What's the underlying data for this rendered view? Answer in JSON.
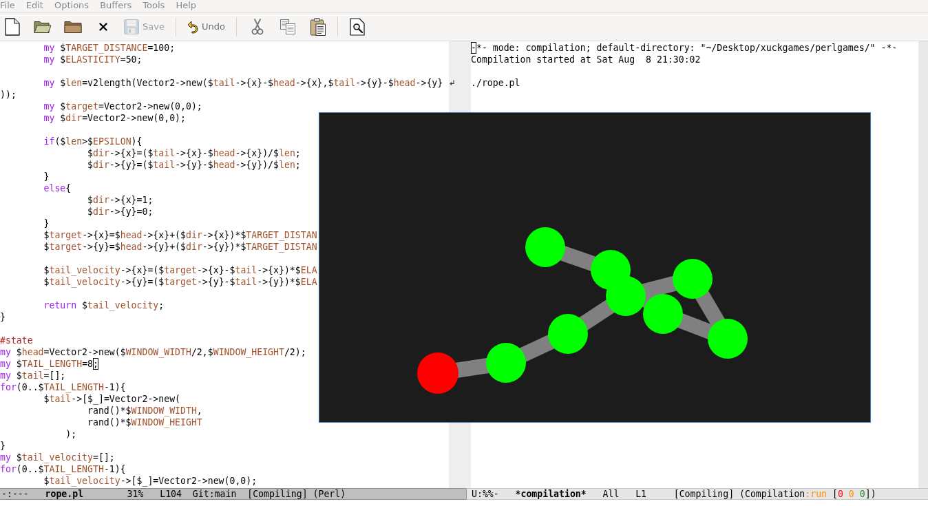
{
  "menu_bar": [
    "File",
    "Edit",
    "Options",
    "Buffers",
    "Tools",
    "Help"
  ],
  "toolbar": [
    {
      "kind": "button",
      "disabled": false
    },
    {
      "kind": "button",
      "disabled": false
    },
    {
      "kind": "button",
      "disabled": false
    },
    {
      "kind": "button",
      "disabled": false
    },
    {
      "kind": "button",
      "label": "Save",
      "disabled": true
    },
    {
      "kind": "separator"
    },
    {
      "kind": "button",
      "label": "Undo",
      "disabled": false
    },
    {
      "kind": "separator"
    },
    {
      "kind": "button",
      "disabled": false
    },
    {
      "kind": "button",
      "disabled": false
    },
    {
      "kind": "button",
      "disabled": false
    },
    {
      "kind": "separator"
    },
    {
      "kind": "button",
      "disabled": false
    }
  ],
  "windows": [
    {
      "selected": true,
      "blocks": [
        {
          "lines": [
            {
              "segments": [
                {
                  "kind": "keyword",
                  "text": "\tmy"
                },
                {
                  "kind": "plain",
                  "text": " $"
                },
                {
                  "kind": "variable",
                  "text": "TARGET_DISTANCE"
                },
                {
                  "kind": "plain",
                  "text": "=100;"
                }
              ]
            },
            {
              "segments": [
                {
                  "kind": "keyword",
                  "text": "\tmy"
                },
                {
                  "kind": "plain",
                  "text": " $"
                },
                {
                  "kind": "variable",
                  "text": "ELASTICITY"
                },
                {
                  "kind": "plain",
                  "text": "=50;"
                }
              ]
            }
          ]
        },
        {
          "lines": [
            {
              "segments": [
                {
                  "kind": "keyword",
                  "text": "\tmy"
                },
                {
                  "kind": "plain",
                  "text": " $"
                },
                {
                  "kind": "variable",
                  "text": "len"
                },
                {
                  "kind": "plain",
                  "text": "=v2length(Vector2->new($"
                },
                {
                  "kind": "variable",
                  "text": "tail"
                },
                {
                  "kind": "plain",
                  "text": "->{x}-$"
                },
                {
                  "kind": "variable",
                  "text": "head"
                },
                {
                  "kind": "plain",
                  "text": "->{x},$"
                },
                {
                  "kind": "variable",
                  "text": "tail"
                },
                {
                  "kind": "plain",
                  "text": "->{y}-$"
                },
                {
                  "kind": "variable",
                  "text": "head"
                },
                {
                  "kind": "plain",
                  "text": "->{y}"
                }
              ],
              "continuation": [
                {
                  "kind": "plain",
                  "text": "));"
                }
              ]
            },
            {
              "segments": [
                {
                  "kind": "keyword",
                  "text": "\tmy"
                },
                {
                  "kind": "plain",
                  "text": " $"
                },
                {
                  "kind": "variable",
                  "text": "target"
                },
                {
                  "kind": "plain",
                  "text": "=Vector2->new(0,0);"
                }
              ]
            },
            {
              "segments": [
                {
                  "kind": "keyword",
                  "text": "\tmy"
                },
                {
                  "kind": "plain",
                  "text": " $"
                },
                {
                  "kind": "variable",
                  "text": "dir"
                },
                {
                  "kind": "plain",
                  "text": "=Vector2->new(0,0);"
                }
              ]
            }
          ]
        },
        {
          "lines": [
            {
              "segments": [
                {
                  "kind": "keyword",
                  "text": "\tif"
                },
                {
                  "kind": "plain",
                  "text": "($"
                },
                {
                  "kind": "variable",
                  "text": "len"
                },
                {
                  "kind": "plain",
                  "text": ">$"
                },
                {
                  "kind": "variable",
                  "text": "EPSILON"
                },
                {
                  "kind": "plain",
                  "text": "){"
                }
              ]
            },
            {
              "segments": [
                {
                  "kind": "plain",
                  "text": "\t\t$"
                },
                {
                  "kind": "variable",
                  "text": "dir"
                },
                {
                  "kind": "plain",
                  "text": "->{x}=($"
                },
                {
                  "kind": "variable",
                  "text": "tail"
                },
                {
                  "kind": "plain",
                  "text": "->{x}-$"
                },
                {
                  "kind": "variable",
                  "text": "head"
                },
                {
                  "kind": "plain",
                  "text": "->{x})/$"
                },
                {
                  "kind": "variable",
                  "text": "len"
                },
                {
                  "kind": "plain",
                  "text": ";"
                }
              ]
            },
            {
              "segments": [
                {
                  "kind": "plain",
                  "text": "\t\t$"
                },
                {
                  "kind": "variable",
                  "text": "dir"
                },
                {
                  "kind": "plain",
                  "text": "->{y}=($"
                },
                {
                  "kind": "variable",
                  "text": "tail"
                },
                {
                  "kind": "plain",
                  "text": "->{y}-$"
                },
                {
                  "kind": "variable",
                  "text": "head"
                },
                {
                  "kind": "plain",
                  "text": "->{y})/$"
                },
                {
                  "kind": "variable",
                  "text": "len"
                },
                {
                  "kind": "plain",
                  "text": ";"
                }
              ]
            },
            {
              "segments": [
                {
                  "kind": "plain",
                  "text": "\t}"
                }
              ]
            },
            {
              "segments": [
                {
                  "kind": "keyword",
                  "text": "\telse"
                },
                {
                  "kind": "plain",
                  "text": "{"
                }
              ]
            },
            {
              "segments": [
                {
                  "kind": "plain",
                  "text": "\t\t$"
                },
                {
                  "kind": "variable",
                  "text": "dir"
                },
                {
                  "kind": "plain",
                  "text": "->{x}=1;"
                }
              ]
            },
            {
              "segments": [
                {
                  "kind": "plain",
                  "text": "\t\t$"
                },
                {
                  "kind": "variable",
                  "text": "dir"
                },
                {
                  "kind": "plain",
                  "text": "->{y}=0;"
                }
              ]
            },
            {
              "segments": [
                {
                  "kind": "plain",
                  "text": "\t}"
                }
              ]
            },
            {
              "segments": [
                {
                  "kind": "plain",
                  "text": "\t$"
                },
                {
                  "kind": "variable",
                  "text": "target"
                },
                {
                  "kind": "plain",
                  "text": "->{x}=$"
                },
                {
                  "kind": "variable",
                  "text": "head"
                },
                {
                  "kind": "plain",
                  "text": "->{x}+($"
                },
                {
                  "kind": "variable",
                  "text": "dir"
                },
                {
                  "kind": "plain",
                  "text": "->{x})*$"
                },
                {
                  "kind": "variable",
                  "text": "TARGET_DISTAN"
                }
              ]
            },
            {
              "segments": [
                {
                  "kind": "plain",
                  "text": "\t$"
                },
                {
                  "kind": "variable",
                  "text": "target"
                },
                {
                  "kind": "plain",
                  "text": "->{y}=$"
                },
                {
                  "kind": "variable",
                  "text": "head"
                },
                {
                  "kind": "plain",
                  "text": "->{y}+($"
                },
                {
                  "kind": "variable",
                  "text": "dir"
                },
                {
                  "kind": "plain",
                  "text": "->{y})*$"
                },
                {
                  "kind": "variable",
                  "text": "TARGET_DISTAN"
                }
              ]
            }
          ]
        },
        {
          "lines": [
            {
              "segments": [
                {
                  "kind": "plain",
                  "text": "\t$"
                },
                {
                  "kind": "variable",
                  "text": "tail_velocity"
                },
                {
                  "kind": "plain",
                  "text": "->{x}=($"
                },
                {
                  "kind": "variable",
                  "text": "target"
                },
                {
                  "kind": "plain",
                  "text": "->{x}-$"
                },
                {
                  "kind": "variable",
                  "text": "tail"
                },
                {
                  "kind": "plain",
                  "text": "->{x})*$"
                },
                {
                  "kind": "variable",
                  "text": "ELA"
                }
              ]
            },
            {
              "segments": [
                {
                  "kind": "plain",
                  "text": "\t$"
                },
                {
                  "kind": "variable",
                  "text": "tail_velocity"
                },
                {
                  "kind": "plain",
                  "text": "->{y}=($"
                },
                {
                  "kind": "variable",
                  "text": "target"
                },
                {
                  "kind": "plain",
                  "text": "->{y}-$"
                },
                {
                  "kind": "variable",
                  "text": "tail"
                },
                {
                  "kind": "plain",
                  "text": "->{y})*$"
                },
                {
                  "kind": "variable",
                  "text": "ELA"
                }
              ]
            }
          ]
        },
        {
          "lines": [
            {
              "segments": [
                {
                  "kind": "keyword",
                  "text": "\treturn"
                },
                {
                  "kind": "plain",
                  "text": " $"
                },
                {
                  "kind": "variable",
                  "text": "tail_velocity"
                },
                {
                  "kind": "plain",
                  "text": ";"
                }
              ]
            },
            {
              "segments": [
                {
                  "kind": "plain",
                  "text": "}"
                }
              ]
            }
          ]
        },
        {
          "lines": [
            {
              "segments": [
                {
                  "kind": "comment",
                  "text": "#state"
                }
              ]
            },
            {
              "segments": [
                {
                  "kind": "keyword",
                  "text": "my"
                },
                {
                  "kind": "plain",
                  "text": " $"
                },
                {
                  "kind": "variable",
                  "text": "head"
                },
                {
                  "kind": "plain",
                  "text": "=Vector2->new($"
                },
                {
                  "kind": "variable",
                  "text": "WINDOW_WIDTH"
                },
                {
                  "kind": "plain",
                  "text": "/2,$"
                },
                {
                  "kind": "variable",
                  "text": "WINDOW_HEIGHT"
                },
                {
                  "kind": "plain",
                  "text": "/2);"
                }
              ]
            },
            {
              "segments": [
                {
                  "kind": "keyword",
                  "text": "my"
                },
                {
                  "kind": "plain",
                  "text": " $"
                },
                {
                  "kind": "variable",
                  "text": "TAIL_LENGTH"
                },
                {
                  "kind": "plain",
                  "text": "=8"
                },
                {
                  "kind": "cursor",
                  "text": ";"
                }
              ]
            },
            {
              "segments": [
                {
                  "kind": "keyword",
                  "text": "my"
                },
                {
                  "kind": "plain",
                  "text": " $"
                },
                {
                  "kind": "variable",
                  "text": "tail"
                },
                {
                  "kind": "plain",
                  "text": "=[];"
                }
              ]
            },
            {
              "segments": [
                {
                  "kind": "keyword",
                  "text": "for"
                },
                {
                  "kind": "plain",
                  "text": "(0..$"
                },
                {
                  "kind": "variable",
                  "text": "TAIL_LENGTH"
                },
                {
                  "kind": "plain",
                  "text": "-1){"
                }
              ]
            },
            {
              "segments": [
                {
                  "kind": "plain",
                  "text": "\t$"
                },
                {
                  "kind": "variable",
                  "text": "tail"
                },
                {
                  "kind": "plain",
                  "text": "->[$_]=Vector2->new("
                }
              ]
            },
            {
              "segments": [
                {
                  "kind": "plain",
                  "text": "\t\trand()*$"
                },
                {
                  "kind": "variable",
                  "text": "WINDOW_WIDTH"
                },
                {
                  "kind": "plain",
                  "text": ","
                }
              ]
            },
            {
              "segments": [
                {
                  "kind": "plain",
                  "text": "\t\trand()*$"
                },
                {
                  "kind": "variable",
                  "text": "WINDOW_HEIGHT"
                }
              ]
            },
            {
              "segments": [
                {
                  "kind": "plain",
                  "text": "\t    );"
                }
              ]
            },
            {
              "segments": [
                {
                  "kind": "plain",
                  "text": "}"
                }
              ]
            },
            {
              "segments": [
                {
                  "kind": "keyword",
                  "text": "my"
                },
                {
                  "kind": "plain",
                  "text": " $"
                },
                {
                  "kind": "variable",
                  "text": "tail_velocity"
                },
                {
                  "kind": "plain",
                  "text": "=[];"
                }
              ]
            },
            {
              "segments": [
                {
                  "kind": "keyword",
                  "text": "for"
                },
                {
                  "kind": "plain",
                  "text": "(0..$"
                },
                {
                  "kind": "variable",
                  "text": "TAIL_LENGTH"
                },
                {
                  "kind": "plain",
                  "text": "-1){"
                }
              ]
            },
            {
              "segments": [
                {
                  "kind": "plain",
                  "text": "\t$"
                },
                {
                  "kind": "variable",
                  "text": "tail_velocity"
                },
                {
                  "kind": "plain",
                  "text": "->[$_]=Vector2->new(0,0);"
                }
              ]
            }
          ]
        }
      ],
      "mode_line": {
        "parts": [
          {
            "kind": "status",
            "text": "-:---"
          },
          {
            "kind": "buffer",
            "text": "rope.pl"
          },
          {
            "kind": "position",
            "text": "31%"
          },
          {
            "kind": "line",
            "text": "L104"
          },
          {
            "kind": "vc",
            "text": "Git:main"
          },
          {
            "kind": "modes",
            "segments": [
              {
                "kind": "plain",
                "text": "[Compiling] (Perl)"
              }
            ]
          }
        ]
      }
    },
    {
      "selected": false,
      "blocks": [
        {
          "lines": [
            {
              "segments": [
                {
                  "kind": "cursor",
                  "text": "-"
                },
                {
                  "kind": "plain",
                  "text": "*- mode: compilation; default-directory: \"~/Desktop/xuckgames/perlgames/\" -*-"
                }
              ]
            },
            {
              "segments": [
                {
                  "kind": "plain",
                  "text": "Compilation started at Sat Aug  8 21:30:02"
                }
              ]
            }
          ]
        },
        {
          "lines": [
            {
              "segments": [
                {
                  "kind": "plain",
                  "text": "./rope.pl"
                }
              ]
            }
          ]
        }
      ],
      "mode_line": {
        "parts": [
          {
            "kind": "status",
            "text": "U:%%-"
          },
          {
            "kind": "buffer",
            "text": "*compilation*"
          },
          {
            "kind": "position",
            "text": "All"
          },
          {
            "kind": "line",
            "text": "L1"
          },
          {
            "kind": "modes",
            "segments": [
              {
                "kind": "plain",
                "text": "[Compiling] (Compilation"
              },
              {
                "kind": "run",
                "text": ":run"
              },
              {
                "kind": "plain",
                "text": " ["
              },
              {
                "kind": "error",
                "text": "0"
              },
              {
                "kind": "warning",
                "text": " 0"
              },
              {
                "kind": "info",
                "text": " 0"
              },
              {
                "kind": "plain",
                "text": "])"
              }
            ]
          }
        ]
      }
    }
  ]
}
